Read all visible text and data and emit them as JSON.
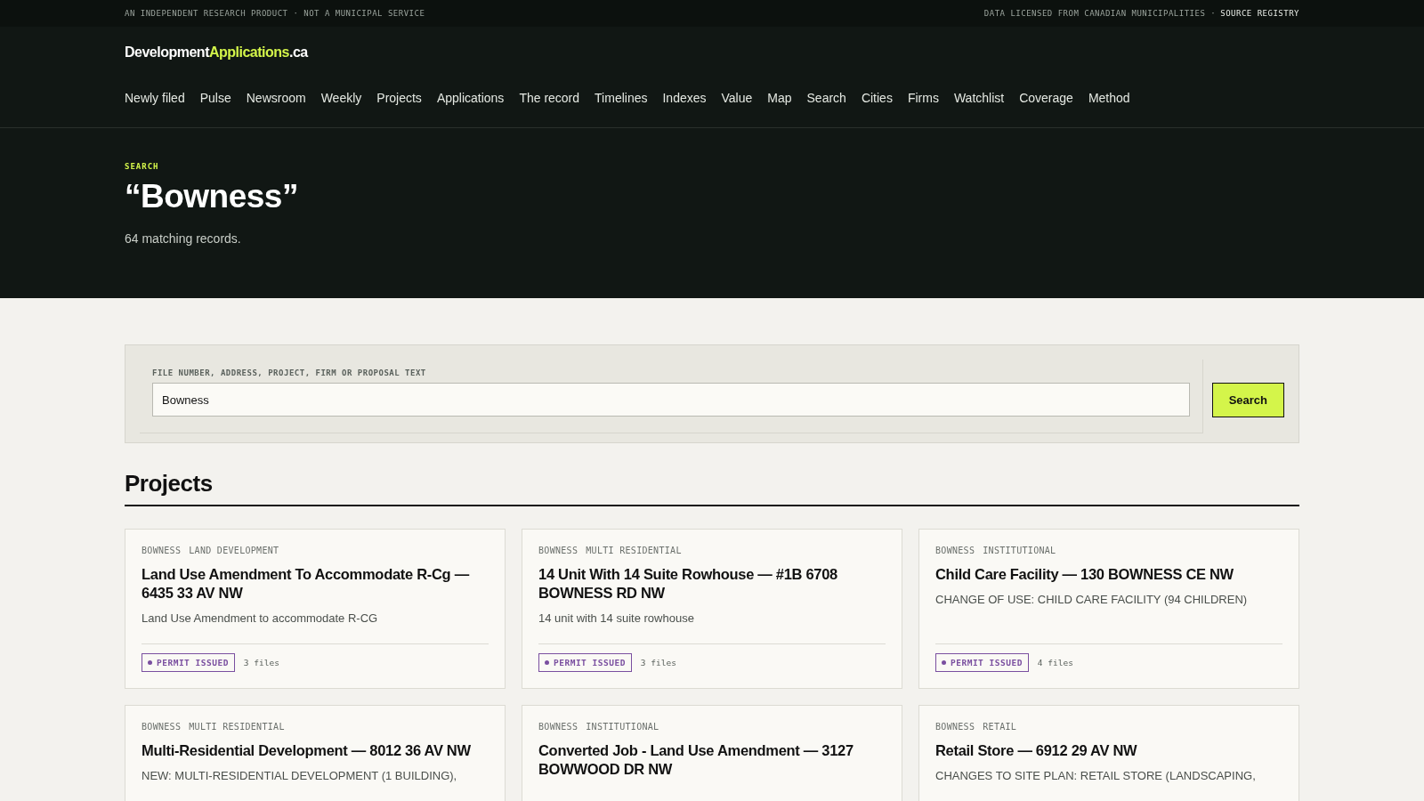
{
  "top_strip": {
    "left": "AN INDEPENDENT RESEARCH PRODUCT · NOT A MUNICIPAL SERVICE",
    "right": "DATA LICENSED FROM CANADIAN MUNICIPALITIES ·",
    "right_link": "SOURCE REGISTRY"
  },
  "logo": {
    "part_1": "Development",
    "part_2": "Applications",
    "part_3": ".ca"
  },
  "nav": [
    "Newly filed",
    "Pulse",
    "Newsroom",
    "Weekly",
    "Projects",
    "Applications",
    "The record",
    "Timelines",
    "Indexes",
    "Value",
    "Map",
    "Search",
    "Cities",
    "Firms",
    "Watchlist",
    "Coverage",
    "Method"
  ],
  "hero": {
    "eyebrow": "SEARCH",
    "title": "“Bowness”",
    "count": "64 matching records."
  },
  "search": {
    "label": "FILE NUMBER, ADDRESS, PROJECT, FIRM OR PROPOSAL TEXT",
    "value": "Bowness",
    "button": "Search"
  },
  "section_title": "Projects",
  "projects": [
    {
      "tags": [
        "BOWNESS",
        "LAND DEVELOPMENT"
      ],
      "title": "Land Use Amendment To Accommodate R-Cg — 6435 33 AV NW",
      "description": "Land Use Amendment to accommodate R-CG",
      "status": "PERMIT ISSUED",
      "color": "#7a4fa0",
      "files": "3 files"
    },
    {
      "tags": [
        "BOWNESS",
        "MULTI RESIDENTIAL"
      ],
      "title": "14 Unit With 14 Suite Rowhouse — #1B 6708 BOWNESS RD NW",
      "description": "14 unit with 14 suite rowhouse",
      "status": "PERMIT ISSUED",
      "color": "#7a4fa0",
      "files": "3 files"
    },
    {
      "tags": [
        "BOWNESS",
        "INSTITUTIONAL"
      ],
      "title": "Child Care Facility — 130 BOWNESS CE NW",
      "description": "CHANGE OF USE: CHILD CARE FACILITY (94 CHILDREN)",
      "status": "PERMIT ISSUED",
      "color": "#7a4fa0",
      "files": "4 files"
    },
    {
      "tags": [
        "BOWNESS",
        "MULTI RESIDENTIAL"
      ],
      "title": "Multi-Residential Development — 8012 36 AV NW",
      "description": "NEW: MULTI-RESIDENTIAL DEVELOPMENT (1 BUILDING),"
    },
    {
      "tags": [
        "BOWNESS",
        "INSTITUTIONAL"
      ],
      "title": "Converted Job - Land Use Amendment — 3127 BOWWOOD DR NW"
    },
    {
      "tags": [
        "BOWNESS",
        "RETAIL"
      ],
      "title": "Retail Store — 6912 29 AV NW",
      "description": "CHANGES TO SITE PLAN: RETAIL STORE (LANDSCAPING,"
    }
  ]
}
